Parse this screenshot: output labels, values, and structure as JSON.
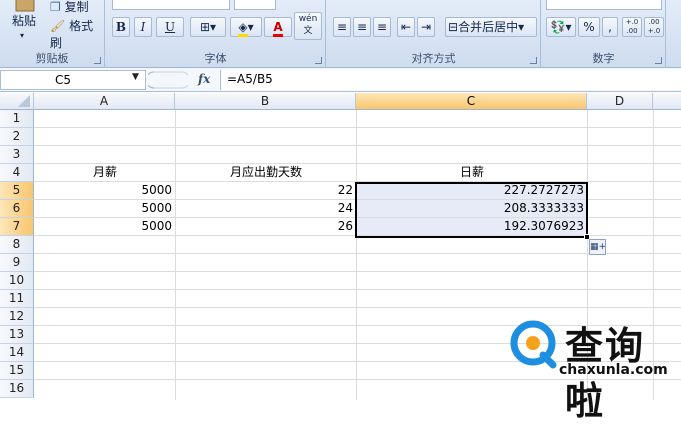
{
  "ribbon": {
    "clipboard": {
      "paste_label": "粘贴",
      "copy_label": "复制",
      "format_painter_label": "格式刷",
      "group_label": "剪贴板"
    },
    "font": {
      "bold": "B",
      "italic": "I",
      "underline": "U",
      "font_color_glyph": "A",
      "phonetic_glyph": "wén 文",
      "group_label": "字体"
    },
    "alignment": {
      "merge_center_label": "合并后居中",
      "group_label": "对齐方式"
    },
    "number": {
      "percent": "%",
      "comma": ",",
      "inc_decimal": "+.0 .00",
      "dec_decimal": ".00 +.0",
      "group_label": "数字"
    }
  },
  "formula_bar": {
    "name_box": "C5",
    "fx": "fx",
    "formula": "=A5/B5"
  },
  "sheet": {
    "columns": [
      "A",
      "B",
      "C",
      "D"
    ],
    "selected_column": "C",
    "rows": [
      "1",
      "2",
      "3",
      "4",
      "5",
      "6",
      "7",
      "8",
      "9",
      "10",
      "11",
      "12",
      "13",
      "14",
      "15",
      "16"
    ],
    "selected_rows": [
      "5",
      "6",
      "7"
    ],
    "headers": {
      "A4": "月薪",
      "B4": "月应出勤天数",
      "C4": "日薪"
    },
    "data": [
      {
        "row": "5",
        "A": "5000",
        "B": "22",
        "C": "227.2727273"
      },
      {
        "row": "6",
        "A": "5000",
        "B": "24",
        "C": "208.3333333"
      },
      {
        "row": "7",
        "A": "5000",
        "B": "26",
        "C": "192.3076923"
      }
    ]
  },
  "watermark": {
    "cn": "查询啦",
    "en": "chaxunla.com"
  },
  "colors": {
    "selection_fill": "#e7ebf7",
    "header_selected": "#f8c66e",
    "logo_blue": "#1e8fe0",
    "logo_orange": "#f5a21b"
  }
}
